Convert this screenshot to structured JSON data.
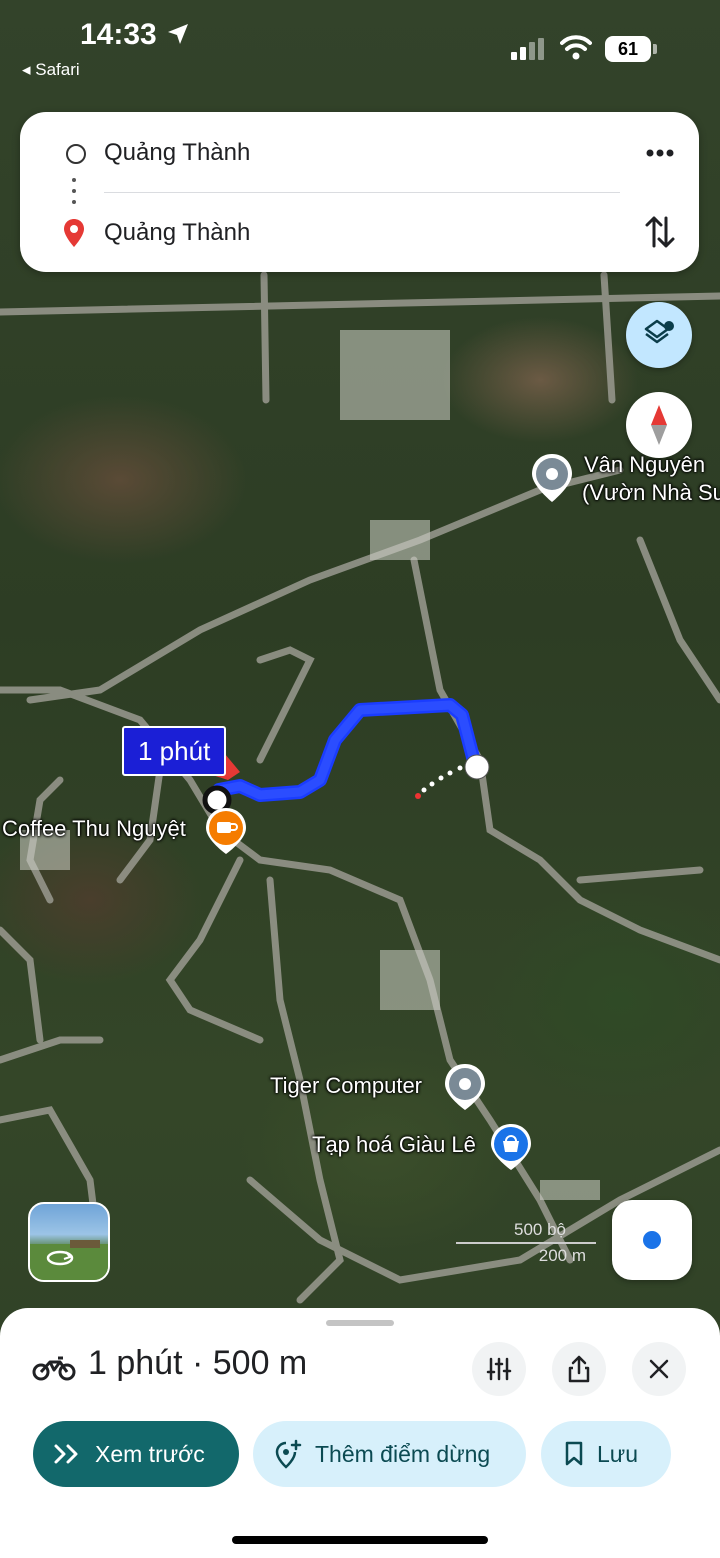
{
  "status_bar": {
    "time": "14:33",
    "back_label": "◂ Safari",
    "battery": "61"
  },
  "route": {
    "origin": "Quảng Thành",
    "destination": "Quảng Thành"
  },
  "map": {
    "eta_bubble": "1 phút",
    "places": {
      "coffee": "Coffee Thu Nguyệt",
      "van_nguyen_line1": "Vân Nguyên",
      "van_nguyen_line2": "(Vườn Nhà Su",
      "tiger": "Tiger Computer",
      "tap_hoa": "Tạp hoá Giàu Lê"
    },
    "scale_top": "500 bộ",
    "scale_bottom": "200 m"
  },
  "sheet": {
    "summary": "1 phút · 500 m",
    "preview_label": "Xem trước",
    "add_stop_label": "Thêm điểm dừng",
    "save_label": "Lưu"
  },
  "colors": {
    "route": "#1a3cff",
    "preview_bg": "#12686b",
    "pill_bg": "#d7f0fb",
    "eta_bg": "#1b1fd6"
  },
  "icons": [
    "location-arrow-icon",
    "signal-icon",
    "wifi-icon",
    "battery-icon",
    "more-icon",
    "swap-icon",
    "layers-icon",
    "compass-icon",
    "recenter-icon",
    "motorbike-icon",
    "options-icon",
    "share-icon",
    "close-icon",
    "chevrons-icon",
    "add-stop-icon",
    "bookmark-icon"
  ]
}
